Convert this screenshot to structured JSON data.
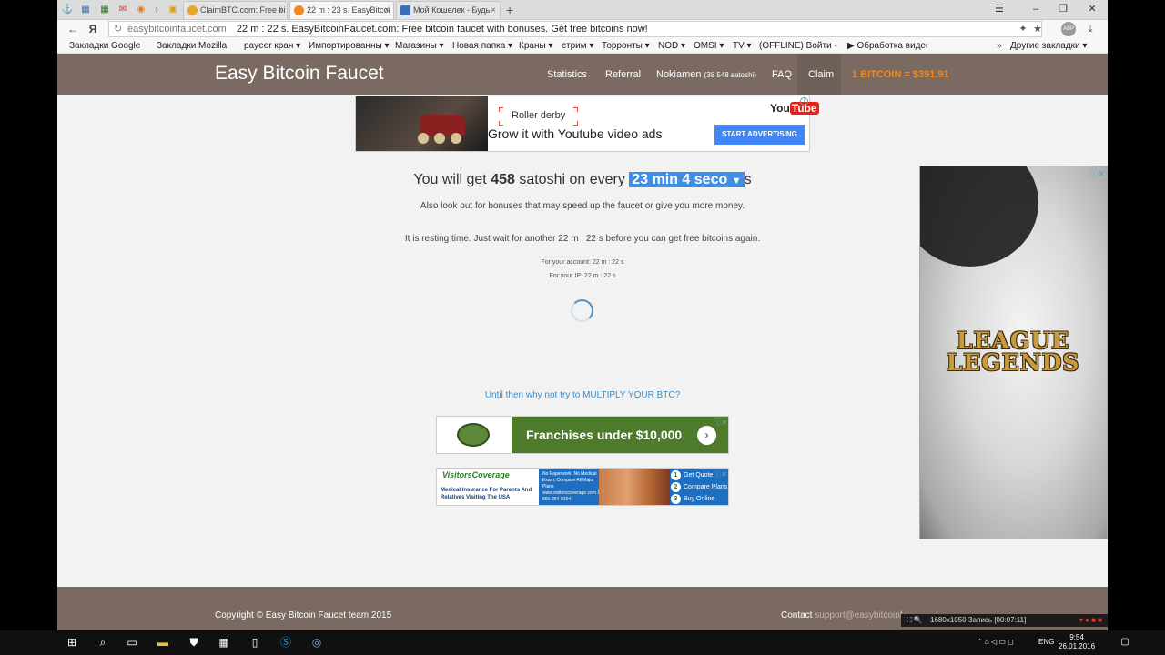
{
  "browser": {
    "tabs": [
      {
        "title": "ClaimBTC.com: Free bi",
        "color": "#e7a52a"
      },
      {
        "title": "22 m : 23 s. EasyBitcoi",
        "color": "#f0891e"
      },
      {
        "title": "Мой Кошелек - Будь",
        "color": "#3b6fb6"
      }
    ],
    "address": {
      "domain": "easybitcoinfaucet.com",
      "title": "22 m : 22 s. EasyBitcoinFaucet.com: Free bitcoin faucet with bonuses. Get free bitcoins now!"
    },
    "bookmarks": [
      "Закладки Google",
      "Закладки Mozilla",
      "payeer кран ▾",
      "Импортированны ▾",
      "Магазины ▾",
      "Новая папка ▾",
      "Краны ▾",
      "стрим ▾",
      "Торронты ▾",
      "NOD ▾",
      "OMSI ▾",
      "TV ▾",
      "(OFFLINE) Войти - R",
      "▶ Обработка видео",
      "Другие закладки ▾"
    ]
  },
  "site": {
    "brand": "Easy Bitcoin Faucet",
    "nav": {
      "statistics": "Statistics",
      "referral": "Referral",
      "user": "Nokiamen",
      "user_balance": "(38 548 satoshi)",
      "faq": "FAQ",
      "claim": "Claim",
      "price": "1 BITCOIN = $391.91"
    },
    "main": {
      "lead_prefix": "You will get ",
      "satoshi": "458",
      "lead_mid": " satoshi on every ",
      "interval": "23 min 4 seco",
      "lead_suffix": "s",
      "bonus_note": "Also look out for bonuses that may speed up the faucet or give you more money.",
      "resting": "It is resting time. Just wait for another 22 m : 22 s before you can get free bitcoins again.",
      "account_timer": "For your account: 22 m : 22 s",
      "ip_timer": "For your IP: 22 m : 22 s",
      "multiply": "Until then why not try to MULTIPLY YOUR BTC?"
    },
    "ads": {
      "top_keyword": "Roller derby",
      "top_headline": "Grow it with Youtube video ads",
      "top_brand_a": "You",
      "top_brand_b": "Tube",
      "top_cta": "START ADVERTISING",
      "franchise": "Franchises under $10,000",
      "visitors_brand": "VisitorsCoverage",
      "visitors_tag": "Medical Insurance For Parents And Relatives Visiting The USA",
      "visitors_mid": "No Paperwork, No Medical Exam, Compare All Major Plans www.visitorscoverage.com 1-866-384-9104",
      "visitors_steps": [
        "Get Quote",
        "Compare Plans",
        "Buy Online"
      ],
      "side_line1": "LEAGUE",
      "side_line2": "LEGENDS"
    },
    "footer": {
      "copyright": "Copyright © Easy Bitcoin Faucet team 2015",
      "contact_label": "Contact ",
      "contact_email": "support@easybitcoinf"
    }
  },
  "recorder": "1680x1050    Запись [00:07:11]",
  "taskbar": {
    "lang": "ENG",
    "time": "9:54",
    "date": "26.01.2016"
  }
}
